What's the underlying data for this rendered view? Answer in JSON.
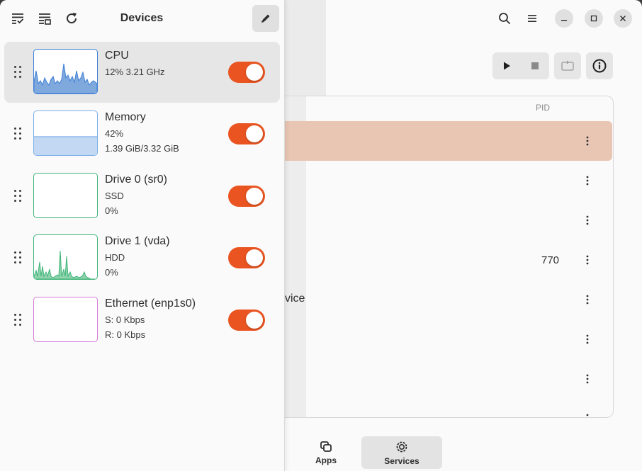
{
  "colors": {
    "accent": "#e95420",
    "selected_row": "#e8c6b3",
    "cpu_graph": "#3d7fd6",
    "memory_graph": "#7aaee8",
    "drive_graph": "#3fb479",
    "ethernet_graph": "#d67ad8"
  },
  "panel": {
    "title": "Devices",
    "header_icons": [
      "checklist-icon",
      "list-details-icon",
      "refresh-icon"
    ],
    "edit_icon": "pencil-icon",
    "devices": [
      {
        "name": "CPU",
        "line1": "12% 3.21 GHz",
        "line2": "",
        "enabled": true,
        "graph": "cpu",
        "selected": true
      },
      {
        "name": "Memory",
        "line1": "42%",
        "line2": "1.39 GiB/3.32 GiB",
        "enabled": true,
        "graph": "memory",
        "usage_fraction": 0.42
      },
      {
        "name": "Drive 0 (sr0)",
        "line1": "SSD",
        "line2": "0%",
        "enabled": true,
        "graph": "drive0"
      },
      {
        "name": "Drive 1 (vda)",
        "line1": "HDD",
        "line2": "0%",
        "enabled": true,
        "graph": "drive1"
      },
      {
        "name": "Ethernet (enp1s0)",
        "line1": "S: 0 Kbps",
        "line2": "R: 0 Kbps",
        "enabled": true,
        "graph": "ethernet"
      }
    ]
  },
  "main": {
    "header_icons": [
      "search-icon",
      "menu-icon"
    ],
    "window_controls": [
      "minimize-icon",
      "maximize-icon",
      "close-icon"
    ],
    "toolbar": [
      "play-icon",
      "stop-icon",
      "restart-icon",
      "info-icon"
    ],
    "columns": {
      "pid": "PID"
    },
    "rows": [
      {
        "fragment": "",
        "pid": "",
        "selected": true
      },
      {
        "fragment": "",
        "pid": ""
      },
      {
        "fragment": "",
        "pid": ""
      },
      {
        "fragment": "",
        "pid": "770"
      },
      {
        "fragment": "vice",
        "pid": ""
      },
      {
        "fragment": "",
        "pid": ""
      },
      {
        "fragment": "",
        "pid": ""
      },
      {
        "fragment": "",
        "pid": ""
      }
    ],
    "view_switcher": [
      {
        "label": "Apps",
        "icon": "apps-icon",
        "active": false
      },
      {
        "label": "Services",
        "icon": "services-gear-icon",
        "active": true
      }
    ]
  }
}
